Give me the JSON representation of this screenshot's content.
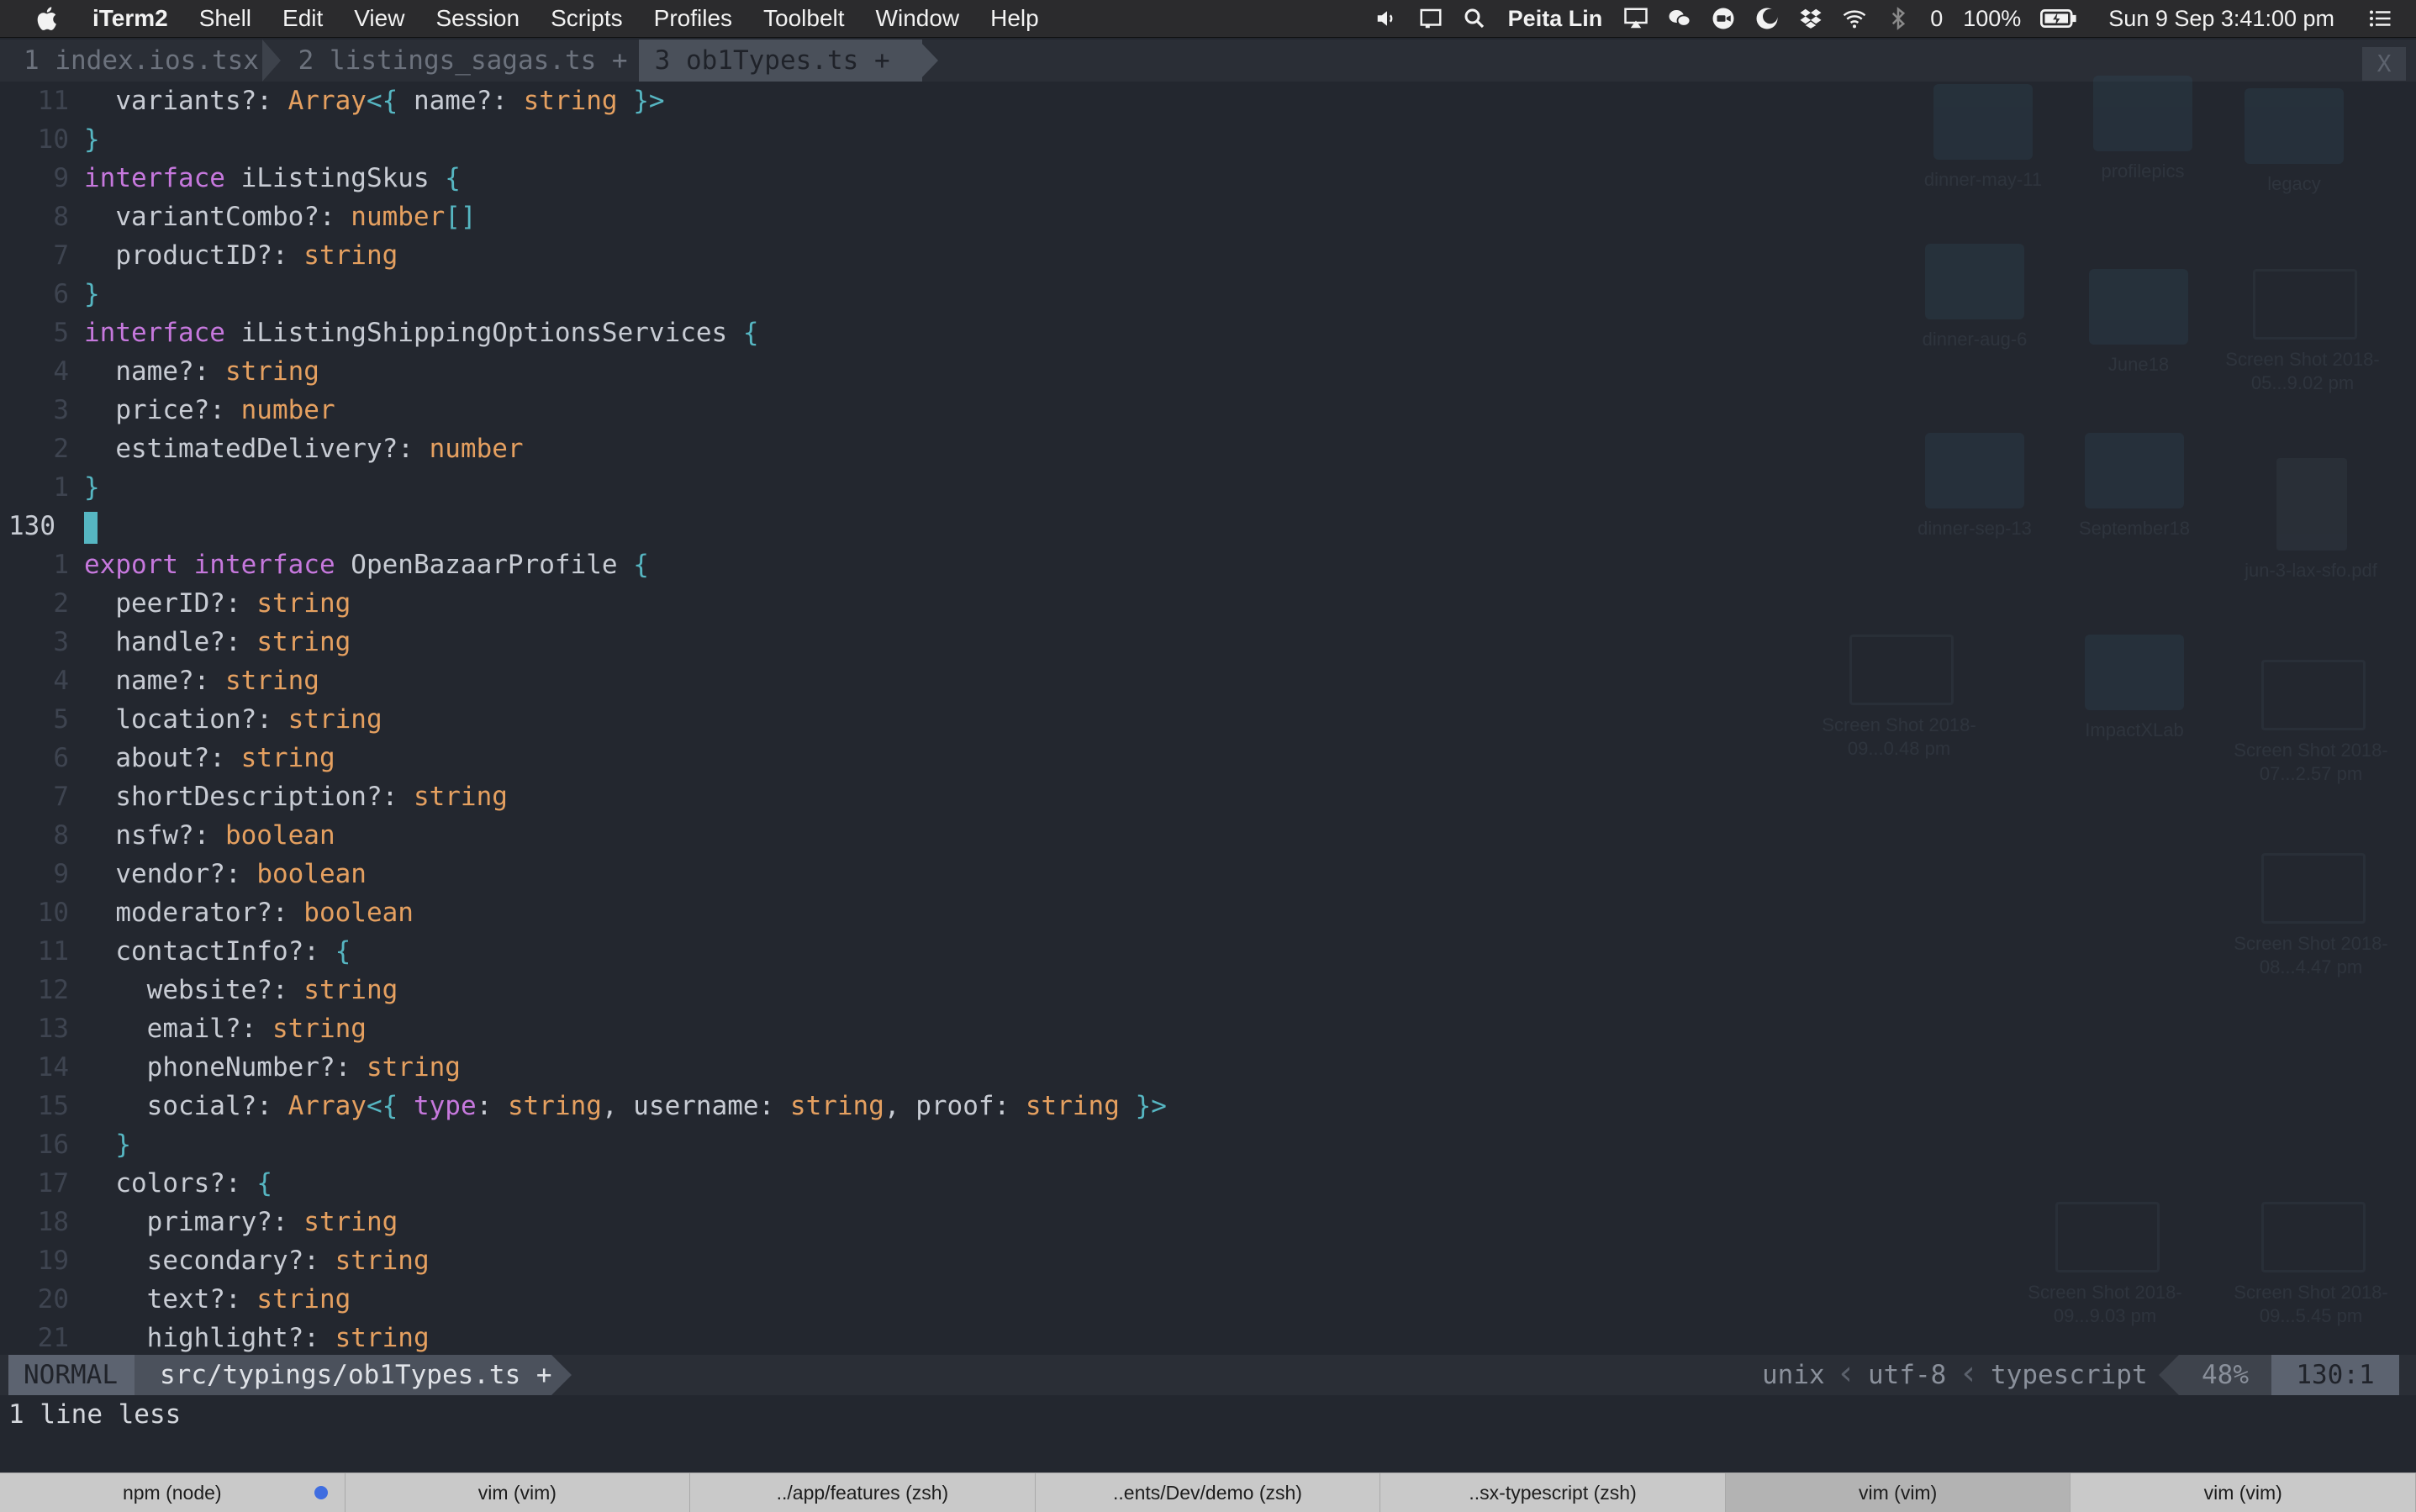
{
  "menubar": {
    "app_name": "iTerm2",
    "menus": [
      "Shell",
      "Edit",
      "View",
      "Session",
      "Scripts",
      "Profiles",
      "Toolbelt",
      "Window",
      "Help"
    ],
    "user": "Peita Lin",
    "notif_count": "0",
    "battery": "100%",
    "clock": "Sun 9 Sep  3:41:00 pm"
  },
  "tabline": {
    "tabs": [
      {
        "label": "1 index.ios.tsx "
      },
      {
        "label": " 2 listings_sagas.ts + "
      },
      {
        "label": " 3 ob1Types.ts + "
      }
    ],
    "close": "X"
  },
  "editor": {
    "lines": [
      {
        "num": "11",
        "html": "  variants?: <span class=\"ty\">Array</span><span class=\"br\">&lt;{</span> name?: <span class=\"ty\">string</span> <span class=\"br\">}&gt;</span>"
      },
      {
        "num": "10",
        "html": "<span class=\"br\">}</span>"
      },
      {
        "num": "9",
        "html": "<span class=\"kw\">interface</span> iListingSkus <span class=\"br\">{</span>"
      },
      {
        "num": "8",
        "html": "  variantCombo?: <span class=\"ty\">number</span><span class=\"br\">[]</span>"
      },
      {
        "num": "7",
        "html": "  productID?: <span class=\"ty\">string</span>"
      },
      {
        "num": "6",
        "html": "<span class=\"br\">}</span>"
      },
      {
        "num": "5",
        "html": "<span class=\"kw\">interface</span> iListingShippingOptionsServices <span class=\"br\">{</span>"
      },
      {
        "num": "4",
        "html": "  name?: <span class=\"ty\">string</span>"
      },
      {
        "num": "3",
        "html": "  price?: <span class=\"ty\">number</span>"
      },
      {
        "num": "2",
        "html": "  estimatedDelivery?: <span class=\"ty\">number</span>"
      },
      {
        "num": "1",
        "html": "<span class=\"br\">}</span>"
      },
      {
        "num": "130",
        "current": true,
        "html": "<span class=\"cursor\"></span>"
      },
      {
        "num": "1",
        "html": "<span class=\"kw\">export interface</span> OpenBazaarProfile <span class=\"br\">{</span>"
      },
      {
        "num": "2",
        "html": "  peerID?: <span class=\"ty\">string</span>"
      },
      {
        "num": "3",
        "html": "  handle?: <span class=\"ty\">string</span>"
      },
      {
        "num": "4",
        "html": "  name?: <span class=\"ty\">string</span>"
      },
      {
        "num": "5",
        "html": "  location?: <span class=\"ty\">string</span>"
      },
      {
        "num": "6",
        "html": "  about?: <span class=\"ty\">string</span>"
      },
      {
        "num": "7",
        "html": "  shortDescription?: <span class=\"ty\">string</span>"
      },
      {
        "num": "8",
        "html": "  nsfw?: <span class=\"ty\">boolean</span>"
      },
      {
        "num": "9",
        "html": "  vendor?: <span class=\"ty\">boolean</span>"
      },
      {
        "num": "10",
        "html": "  moderator?: <span class=\"ty\">boolean</span>"
      },
      {
        "num": "11",
        "html": "  contactInfo?: <span class=\"br\">{</span>"
      },
      {
        "num": "12",
        "html": "    website?: <span class=\"ty\">string</span>"
      },
      {
        "num": "13",
        "html": "    email?: <span class=\"ty\">string</span>"
      },
      {
        "num": "14",
        "html": "    phoneNumber?: <span class=\"ty\">string</span>"
      },
      {
        "num": "15",
        "html": "    social?: <span class=\"ty\">Array</span><span class=\"br\">&lt;{</span> <span class=\"kw\">type</span>: <span class=\"ty\">string</span>, username: <span class=\"ty\">string</span>, proof: <span class=\"ty\">string</span> <span class=\"br\">}&gt;</span>"
      },
      {
        "num": "16",
        "html": "  <span class=\"br\">}</span>"
      },
      {
        "num": "17",
        "html": "  colors?: <span class=\"br\">{</span>"
      },
      {
        "num": "18",
        "html": "    primary?: <span class=\"ty\">string</span>"
      },
      {
        "num": "19",
        "html": "    secondary?: <span class=\"ty\">string</span>"
      },
      {
        "num": "20",
        "html": "    text?: <span class=\"ty\">string</span>"
      },
      {
        "num": "21",
        "html": "    highlight?: <span class=\"ty\">string</span>"
      }
    ]
  },
  "desktop": {
    "items": [
      {
        "kind": "folder",
        "label": "dinner-may-11"
      },
      {
        "kind": "folder",
        "label": "profilepics"
      },
      {
        "kind": "folder",
        "label": "legacy"
      },
      {
        "kind": "folder",
        "label": "dinner-aug-6"
      },
      {
        "kind": "folder",
        "label": "June18"
      },
      {
        "kind": "shot",
        "label": "Screen Shot 2018-05...9.02 pm"
      },
      {
        "kind": "folder",
        "label": "dinner-sep-13"
      },
      {
        "kind": "folder",
        "label": "September18"
      },
      {
        "kind": "doc",
        "label": "jun-3-lax-sfo.pdf"
      },
      {
        "kind": "shot",
        "label": "Screen Shot 2018-09...0.48 pm"
      },
      {
        "kind": "folder",
        "label": "ImpactXLab"
      },
      {
        "kind": "shot",
        "label": "Screen Shot 2018-07...2.57 pm"
      },
      {
        "kind": "shot",
        "label": "Screen Shot 2018-08...4.47 pm"
      },
      {
        "kind": "shot",
        "label": "Screen Shot 2018-09...9.03 pm"
      },
      {
        "kind": "shot",
        "label": "Screen Shot 2018-09...5.45 pm"
      }
    ]
  },
  "statusline": {
    "mode": "NORMAL",
    "filepath": "src/typings/ob1Types.ts +",
    "fileformat": "unix",
    "encoding": "utf-8",
    "filetype": "typescript",
    "percent": "48%",
    "position": "130:1"
  },
  "message": "1 line less",
  "iterm_tabs": [
    {
      "label": "npm (node)",
      "activity": true
    },
    {
      "label": "vim (vim)"
    },
    {
      "label": "../app/features (zsh)"
    },
    {
      "label": "..ents/Dev/demo (zsh)"
    },
    {
      "label": "..sx-typescript (zsh)"
    },
    {
      "label": "vim (vim)",
      "active": true
    },
    {
      "label": "vim (vim)"
    }
  ],
  "colors": {
    "keyword": "#c678dd",
    "type": "#e5a060",
    "bracket": "#56b6c2",
    "text": "#c8ccd4",
    "background": "#23272f"
  }
}
